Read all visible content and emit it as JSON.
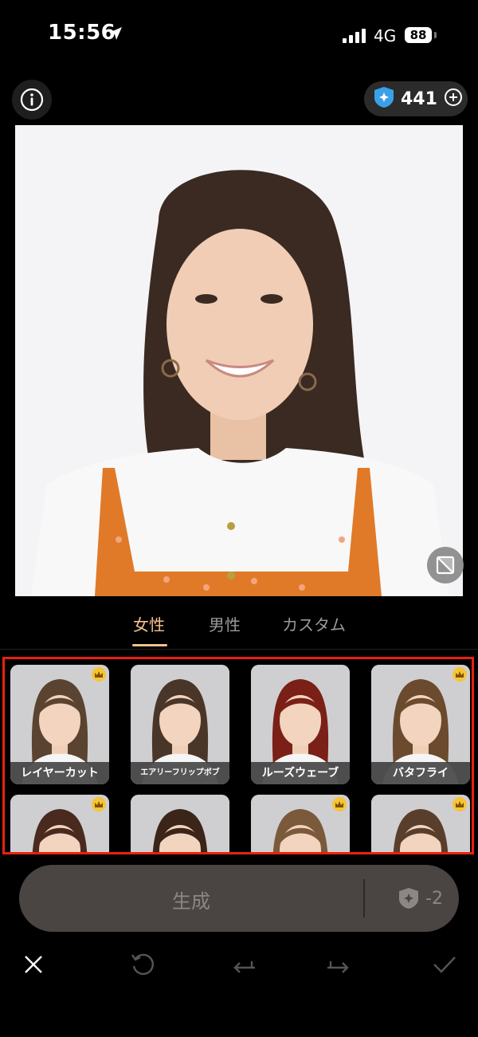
{
  "status": {
    "time": "15:56",
    "network": "4G",
    "battery": "88"
  },
  "header": {
    "credits": "441"
  },
  "tabs": [
    {
      "label": "女性",
      "active": true
    },
    {
      "label": "男性",
      "active": false
    },
    {
      "label": "カスタム",
      "active": false
    }
  ],
  "styles": [
    {
      "label": "レイヤーカット",
      "premium": true,
      "hair": "#5a4330"
    },
    {
      "label": "エアリーフリップボブ",
      "premium": false,
      "hair": "#4a3628"
    },
    {
      "label": "ルーズウェーブ",
      "premium": false,
      "hair": "#7a2016"
    },
    {
      "label": "バタフライ",
      "premium": true,
      "hair": "#6b4a2e"
    },
    {
      "label": "",
      "premium": true,
      "hair": "#4a2a1e"
    },
    {
      "label": "",
      "premium": false,
      "hair": "#3b2418"
    },
    {
      "label": "",
      "premium": true,
      "hair": "#7a5a3a"
    },
    {
      "label": "",
      "premium": true,
      "hair": "#5a3e2c"
    }
  ],
  "generate": {
    "label": "生成",
    "cost": "-2"
  },
  "colors": {
    "accent": "#f5c08e",
    "highlight_box": "#e8210f"
  }
}
